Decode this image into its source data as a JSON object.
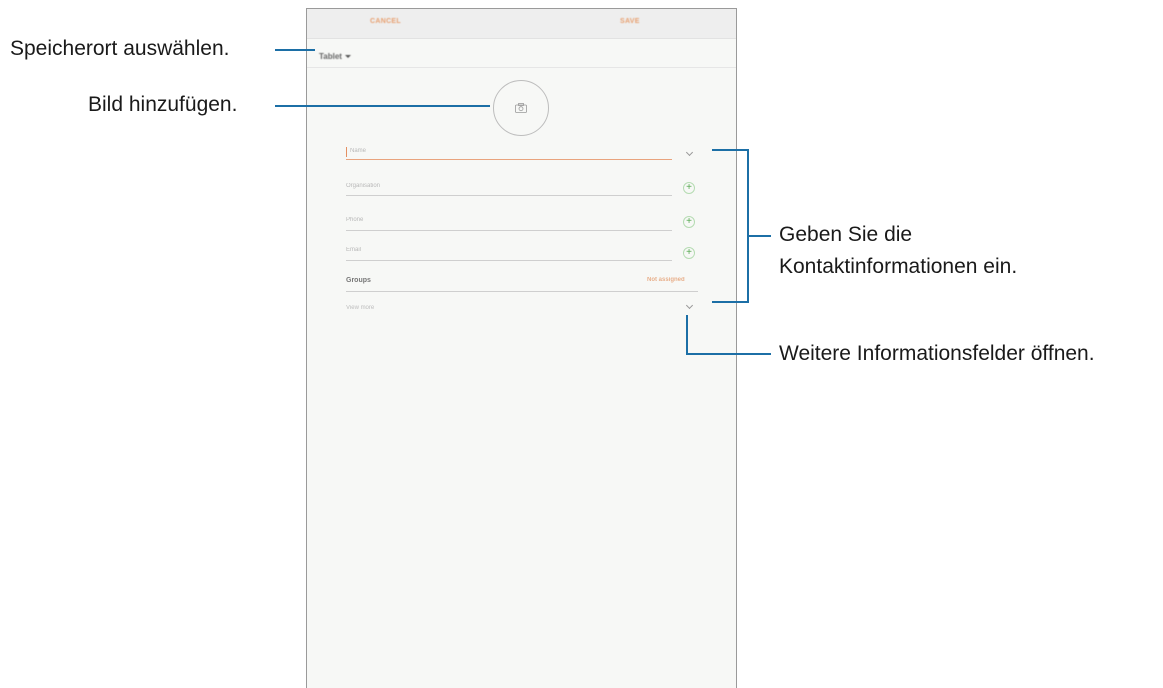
{
  "appbar": {
    "cancel_label": "CANCEL",
    "save_label": "SAVE"
  },
  "storage": {
    "label": "Tablet"
  },
  "fields": {
    "name": "Name",
    "organisation": "Organisation",
    "phone": "Phone",
    "email": "Email"
  },
  "groups": {
    "label": "Groups",
    "value": "Not assigned"
  },
  "view_more": {
    "label": "View more"
  },
  "callouts": {
    "storage": "Speicherort auswählen.",
    "picture": "Bild hinzufügen.",
    "contact_line1": "Geben Sie die",
    "contact_line2": "Kontaktinformationen ein.",
    "more_fields": "Weitere Informationsfelder öffnen."
  },
  "colors": {
    "accent": "#e8a070",
    "callout_line": "#1c6fa6",
    "plus_green": "#55a84f"
  }
}
